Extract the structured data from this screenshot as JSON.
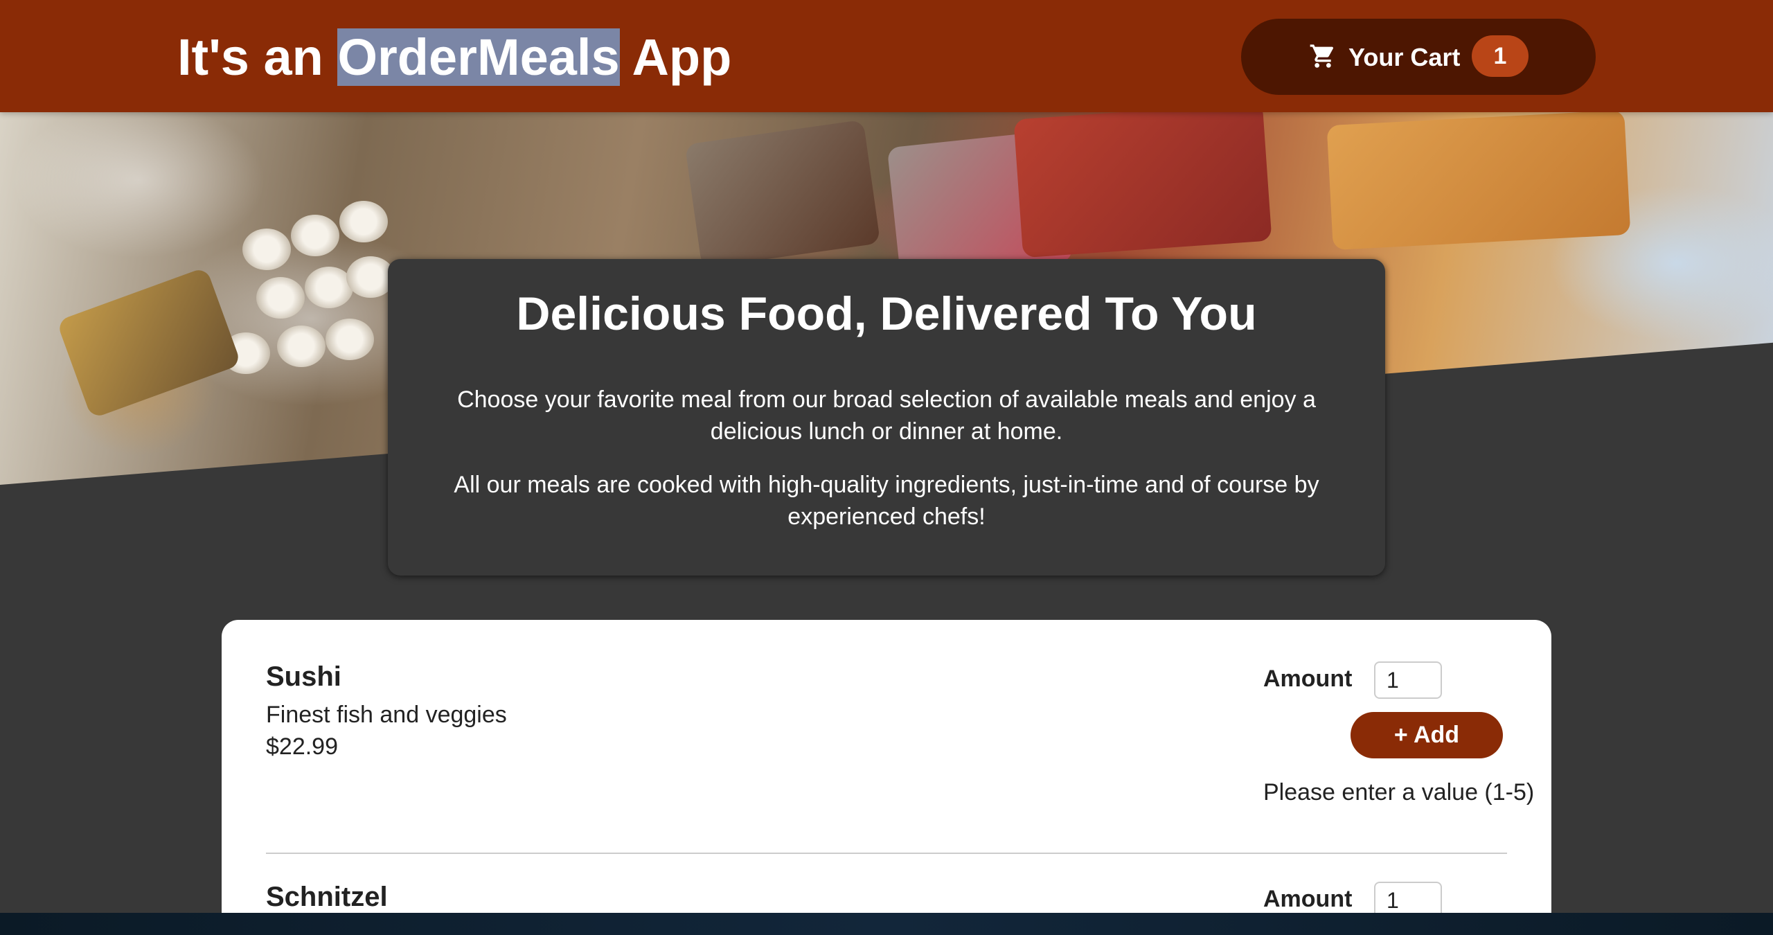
{
  "header": {
    "title_prefix": "It's an ",
    "title_highlight": "OrderMeals",
    "title_suffix": " App",
    "cart_label": "Your Cart",
    "cart_count": "1",
    "cart_icon": "shopping-cart-icon"
  },
  "summary": {
    "heading": "Delicious Food, Delivered To You",
    "paragraph1": "Choose your favorite meal from our broad selection of available meals and enjoy a delicious lunch or dinner at home.",
    "paragraph2": "All our meals are cooked with high-quality ingredients, just-in-time and of course by experienced chefs!"
  },
  "meals": [
    {
      "name": "Sushi",
      "description": "Finest fish and veggies",
      "price": "$22.99",
      "amount_label": "Amount",
      "amount_value": "1",
      "add_label": "+ Add",
      "validation": "Please enter a value (1-5)"
    },
    {
      "name": "Schnitzel",
      "amount_label": "Amount",
      "amount_value": "1"
    }
  ],
  "colors": {
    "header_bg": "#8a2b06",
    "cart_button_bg": "#4d1601",
    "badge_bg": "#b94517",
    "page_bg": "#383838",
    "add_button_bg": "#8a2b06",
    "highlight": "#7b86a6"
  }
}
